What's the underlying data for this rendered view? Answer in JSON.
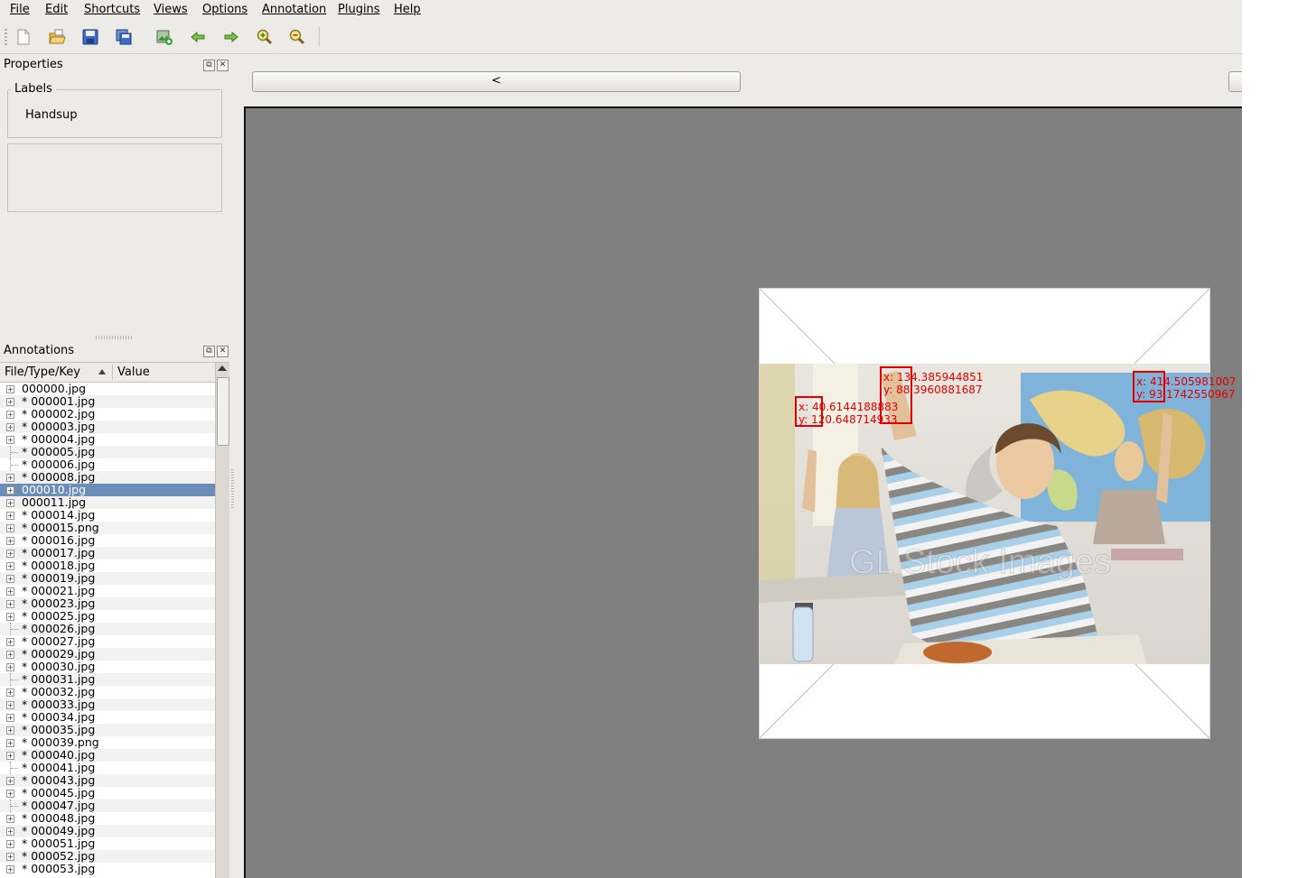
{
  "menu": [
    "File",
    "Edit",
    "Shortcuts",
    "Views",
    "Options",
    "Annotation",
    "Plugins",
    "Help"
  ],
  "toolbar": {
    "icons": [
      "new-file-icon",
      "open-folder-icon",
      "save-icon",
      "save-as-icon",
      "add-image-icon",
      "arrow-left-icon",
      "arrow-right-icon",
      "zoom-in-icon",
      "zoom-out-icon"
    ]
  },
  "properties": {
    "title": "Properties",
    "labels_group_title": "Labels",
    "labels": [
      "Handsup"
    ]
  },
  "annotations": {
    "title": "Annotations",
    "columns": [
      "File/Type/Key",
      "Value"
    ],
    "files": [
      {
        "name": "000000.jpg",
        "expandable": true
      },
      {
        "name": "* 000001.jpg",
        "expandable": true
      },
      {
        "name": "* 000002.jpg",
        "expandable": true
      },
      {
        "name": "* 000003.jpg",
        "expandable": true
      },
      {
        "name": "* 000004.jpg",
        "expandable": true
      },
      {
        "name": "* 000005.jpg",
        "expandable": false
      },
      {
        "name": "* 000006.jpg",
        "expandable": false
      },
      {
        "name": "* 000008.jpg",
        "expandable": true
      },
      {
        "name": "000010.jpg",
        "expandable": true,
        "selected": true
      },
      {
        "name": "000011.jpg",
        "expandable": true
      },
      {
        "name": "* 000014.jpg",
        "expandable": true
      },
      {
        "name": "* 000015.png",
        "expandable": true
      },
      {
        "name": "* 000016.jpg",
        "expandable": true
      },
      {
        "name": "* 000017.jpg",
        "expandable": true
      },
      {
        "name": "* 000018.jpg",
        "expandable": true
      },
      {
        "name": "* 000019.jpg",
        "expandable": true
      },
      {
        "name": "* 000021.jpg",
        "expandable": true
      },
      {
        "name": "* 000023.jpg",
        "expandable": true
      },
      {
        "name": "* 000025.jpg",
        "expandable": true
      },
      {
        "name": "* 000026.jpg",
        "expandable": false
      },
      {
        "name": "* 000027.jpg",
        "expandable": true
      },
      {
        "name": "* 000029.jpg",
        "expandable": true
      },
      {
        "name": "* 000030.jpg",
        "expandable": true
      },
      {
        "name": "* 000031.jpg",
        "expandable": false
      },
      {
        "name": "* 000032.jpg",
        "expandable": true
      },
      {
        "name": "* 000033.jpg",
        "expandable": true
      },
      {
        "name": "* 000034.jpg",
        "expandable": true
      },
      {
        "name": "* 000035.jpg",
        "expandable": true
      },
      {
        "name": "* 000039.png",
        "expandable": true
      },
      {
        "name": "* 000040.jpg",
        "expandable": true
      },
      {
        "name": "* 000041.jpg",
        "expandable": false
      },
      {
        "name": "* 000043.jpg",
        "expandable": true
      },
      {
        "name": "* 000045.jpg",
        "expandable": true
      },
      {
        "name": "* 000047.jpg",
        "expandable": false
      },
      {
        "name": "* 000048.jpg",
        "expandable": true
      },
      {
        "name": "* 000049.jpg",
        "expandable": true
      },
      {
        "name": "* 000051.jpg",
        "expandable": true
      },
      {
        "name": "* 000052.jpg",
        "expandable": true
      },
      {
        "name": "* 000053.jpg",
        "expandable": true
      }
    ]
  },
  "viewer": {
    "prev_button_label": "<",
    "annotations": [
      {
        "x_label": "x: 40.6144188883",
        "y_label": "y: 120.648714933"
      },
      {
        "x_label": "x: 134.385944851",
        "y_label": "y: 88.3960881687"
      },
      {
        "x_label": "x: 414.505981007",
        "y_label": "y: 93.1742550967"
      }
    ],
    "watermark": "GL Stock Images"
  },
  "colors": {
    "selection": "#6a8eb8",
    "bbox": "#e00000",
    "canvas": "#808080"
  }
}
